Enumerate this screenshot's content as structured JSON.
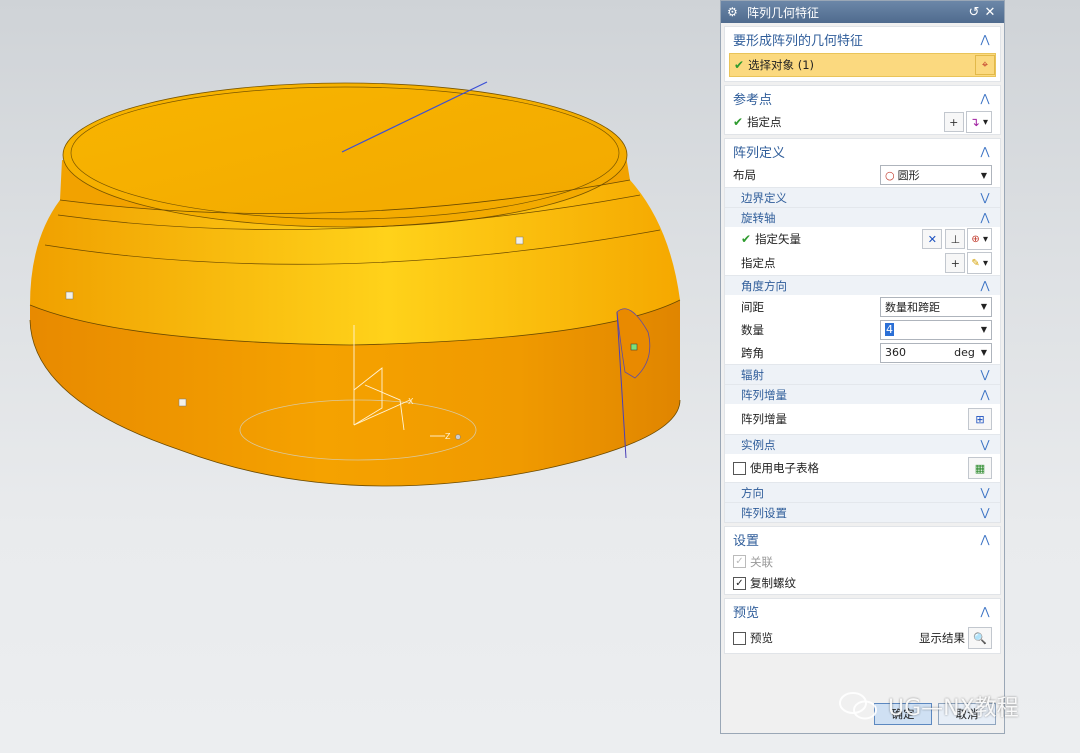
{
  "dialog": {
    "title": "阵列几何特征",
    "reset_icon": "reset-icon",
    "close_icon": "close-icon",
    "sections": {
      "geometry": {
        "header": "要形成阵列的几何特征",
        "select_label": "选择对象 (1)"
      },
      "reference": {
        "header": "参考点",
        "point_label": "指定点"
      },
      "pattern": {
        "header": "阵列定义",
        "layout_label": "布局",
        "layout_value": "圆形",
        "boundary_header": "边界定义",
        "rotation_header": "旋转轴",
        "vector_label": "指定矢量",
        "axis_point_label": "指定点",
        "angle_header": "角度方向",
        "spacing_label": "间距",
        "spacing_value": "数量和跨距",
        "count_label": "数量",
        "count_value": "4",
        "span_label": "跨角",
        "span_value": "360",
        "span_unit": "deg",
        "radiate_header": "辐射",
        "increment_header": "阵列增量",
        "increment_label": "阵列增量",
        "instance_header": "实例点",
        "spreadsheet_label": "使用电子表格",
        "direction_header": "方向",
        "pattern_settings_header": "阵列设置"
      },
      "settings": {
        "header": "设置",
        "associative_label": "关联",
        "copy_threads_label": "复制螺纹"
      },
      "preview": {
        "header": "预览",
        "preview_label": "预览",
        "show_result_label": "显示结果"
      }
    },
    "ok_label": "确定",
    "cancel_label": "取消"
  },
  "viewport": {
    "part_color": "#f5a200",
    "axis_labels": {
      "x": "X",
      "z": "Z"
    }
  },
  "watermark": {
    "text": "UG—NX教程"
  },
  "colors": {
    "accent": "#2f5d9a",
    "selection": "#fbd97f",
    "title_bar": "#5a7599"
  }
}
